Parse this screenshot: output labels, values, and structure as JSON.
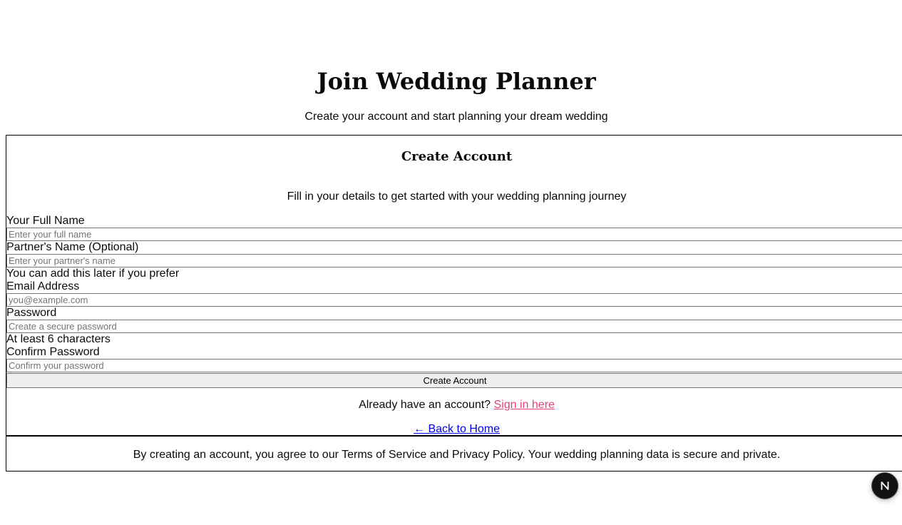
{
  "header": {
    "title": "Join Wedding Planner",
    "subtitle": "Create your account and start planning your dream wedding"
  },
  "card": {
    "title": "Create Account",
    "description": "Fill in your details to get started with your wedding planning journey"
  },
  "form": {
    "full_name": {
      "label": "Your Full Name",
      "placeholder": "Enter your full name",
      "value": ""
    },
    "partner_name": {
      "label": "Partner's Name (Optional)",
      "placeholder": "Enter your partner's name",
      "value": "",
      "hint": "You can add this later if you prefer"
    },
    "email": {
      "label": "Email Address",
      "placeholder": "you@example.com",
      "value": ""
    },
    "password": {
      "label": "Password",
      "placeholder": "Create a secure password",
      "value": "",
      "hint": "At least 6 characters"
    },
    "confirm_password": {
      "label": "Confirm Password",
      "placeholder": "Confirm your password",
      "value": ""
    },
    "submit_label": "Create Account"
  },
  "signin": {
    "prompt": "Already have an account?",
    "link_label": "Sign in here"
  },
  "back_link_label": "← Back to Home",
  "footer": {
    "text": "By creating an account, you agree to our Terms of Service and Privacy Policy. Your wedding planning data is secure and private."
  },
  "dev_badge": {
    "icon": "next-n-icon",
    "background": "#111111"
  },
  "colors": {
    "signin_link": "#e0447a",
    "back_link": "#0000ee"
  }
}
